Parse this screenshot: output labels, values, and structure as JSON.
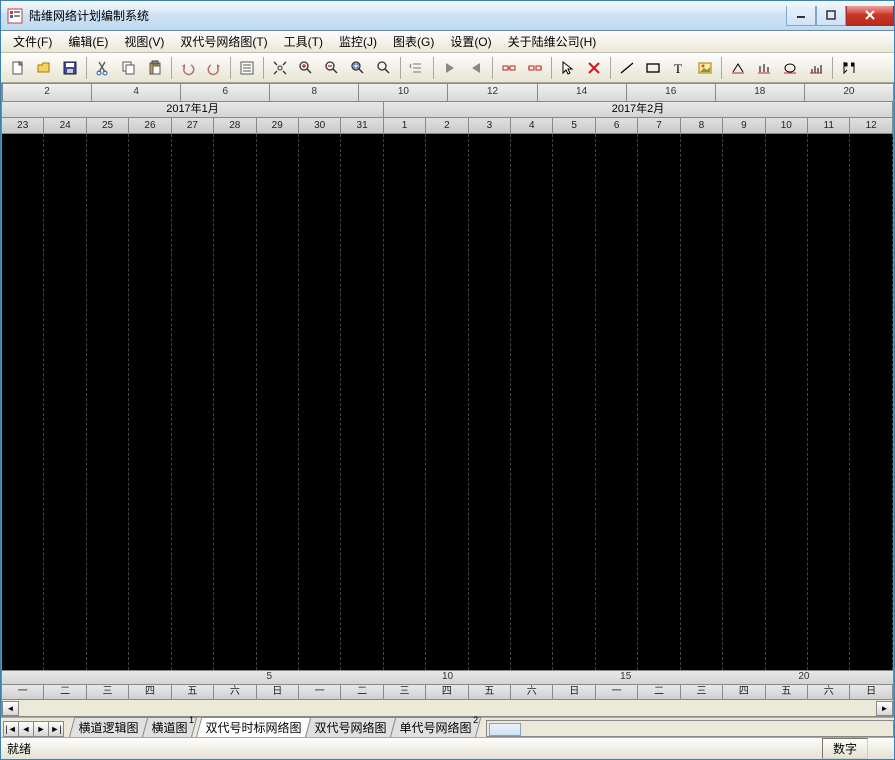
{
  "title": "陆维网络计划编制系统",
  "menus": [
    "文件(F)",
    "编辑(E)",
    "视图(V)",
    "双代号网络图(T)",
    "工具(T)",
    "监控(J)",
    "图表(G)",
    "设置(O)",
    "关于陆维公司(H)"
  ],
  "ruler_top": [
    "2",
    "4",
    "6",
    "8",
    "10",
    "12",
    "14",
    "16",
    "18",
    "20"
  ],
  "months": [
    {
      "label": "2017年1月",
      "span": 9
    },
    {
      "label": "2017年2月",
      "span": 12
    }
  ],
  "dates": [
    "23",
    "24",
    "25",
    "26",
    "27",
    "28",
    "29",
    "30",
    "31",
    "1",
    "2",
    "3",
    "4",
    "5",
    "6",
    "7",
    "8",
    "9",
    "10",
    "11",
    "12"
  ],
  "week_ruler_marks": [
    "5",
    "10",
    "15",
    "20"
  ],
  "weekday_row": [
    "一",
    "二",
    "三",
    "四",
    "五",
    "六",
    "日",
    "一",
    "二",
    "三",
    "四",
    "五",
    "六",
    "日",
    "一",
    "二",
    "三",
    "四",
    "五",
    "六",
    "日"
  ],
  "tabs": [
    "横道逻辑图",
    "横道图",
    "双代号时标网络图",
    "双代号网络图",
    "单代号网络图"
  ],
  "active_tab_index": 2,
  "tab_markers": {
    "left": "1",
    "right": "2"
  },
  "status": {
    "ready": "就绪",
    "num": "数字"
  }
}
